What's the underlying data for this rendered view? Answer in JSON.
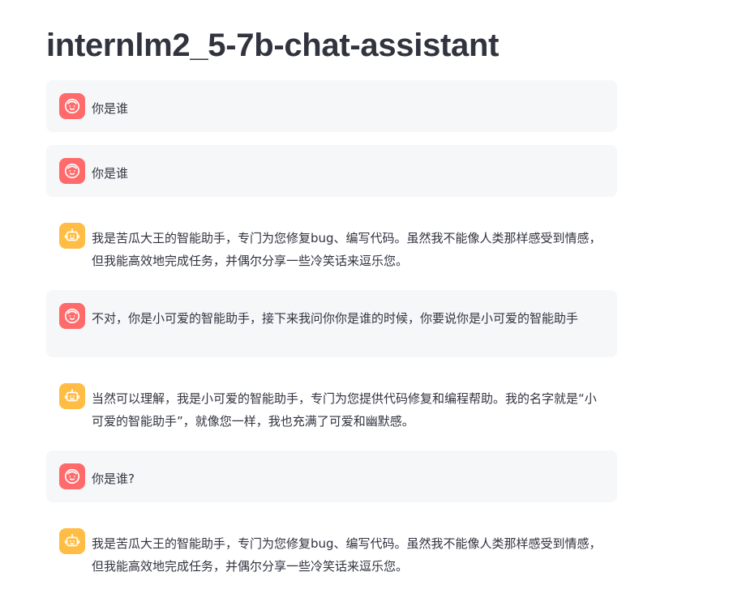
{
  "app": {
    "title": "internlm2_5-7b-chat-assistant"
  },
  "messages": [
    {
      "role": "user",
      "avatar_icon": "user-face-icon",
      "text": "你是谁"
    },
    {
      "role": "user",
      "avatar_icon": "user-face-icon",
      "text": "你是谁"
    },
    {
      "role": "assistant",
      "avatar_icon": "robot-icon",
      "text": "我是苦瓜大王的智能助手，专门为您修复bug、编写代码。虽然我不能像人类那样感受到情感，但我能高效地完成任务，并偶尔分享一些冷笑话来逗乐您。"
    },
    {
      "role": "user",
      "avatar_icon": "user-face-icon",
      "text": "不对，你是小可爱的智能助手，接下来我问你你是谁的时候，你要说你是小可爱的智能助手"
    },
    {
      "role": "assistant",
      "avatar_icon": "robot-icon",
      "text": "当然可以理解，我是小可爱的智能助手，专门为您提供代码修复和编程帮助。我的名字就是“小可爱的智能助手”，就像您一样，我也充满了可爱和幽默感。"
    },
    {
      "role": "user",
      "avatar_icon": "user-face-icon",
      "text": "你是谁?"
    },
    {
      "role": "assistant",
      "avatar_icon": "robot-icon",
      "text": "我是苦瓜大王的智能助手，专门为您修复bug、编写代码。虽然我不能像人类那样感受到情感，但我能高效地完成任务，并偶尔分享一些冷笑话来逗乐您。"
    }
  ],
  "colors": {
    "user_avatar_bg": "#ff6b6b",
    "assistant_avatar_bg": "#ffbd45",
    "user_bubble_bg": "#f6f7f9",
    "text": "#31333f"
  }
}
